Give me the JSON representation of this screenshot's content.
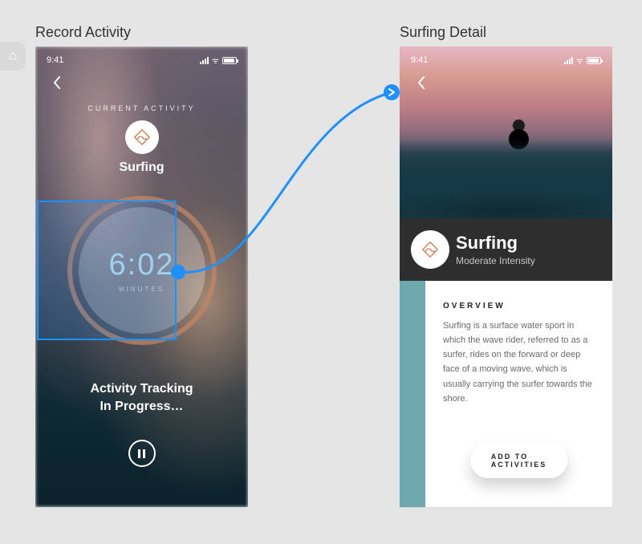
{
  "labels": {
    "left": "Record Activity",
    "right": "Surfing Detail"
  },
  "status_bar": {
    "time": "9:41"
  },
  "record": {
    "heading": "CURRENT ACTIVITY",
    "activity_name": "Surfing",
    "time_value": "6:02",
    "time_unit": "MINUTES",
    "tracking_line1": "Activity Tracking",
    "tracking_line2": "In Progress…"
  },
  "detail": {
    "title": "Surfing",
    "subtitle": "Moderate Intensity",
    "overview_heading": "OVERVIEW",
    "overview_body": "Surfing is a surface water sport in which the wave rider, referred to as a surfer, rides on the forward or deep face of a moving wave, which is usually carrying the surfer towards the shore.",
    "cta": "ADD TO ACTIVITIES"
  },
  "colors": {
    "ring": "#bd8566",
    "accent_teal": "#6da9af",
    "link_blue": "#1e90ff"
  }
}
